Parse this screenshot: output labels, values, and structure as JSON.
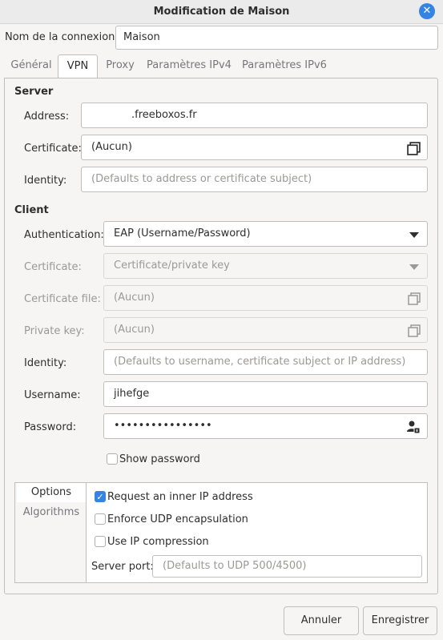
{
  "window": {
    "title": "Modification de Maison"
  },
  "connection": {
    "name_label": "Nom de la connexion",
    "name_value": "Maison"
  },
  "tabs": [
    "Général",
    "VPN",
    "Proxy",
    "Paramètres IPv4",
    "Paramètres IPv6"
  ],
  "server": {
    "heading": "Server",
    "address_label": "Address:",
    "address_value": ".freeboxos.fr",
    "certificate_label": "Certificate:",
    "certificate_value": "(Aucun)",
    "identity_label": "Identity:",
    "identity_placeholder": "(Defaults to address or certificate subject)"
  },
  "client": {
    "heading": "Client",
    "auth_label": "Authentication:",
    "auth_value": "EAP (Username/Password)",
    "certificate_label": "Certificate:",
    "certificate_value": "Certificate/private key",
    "certfile_label": "Certificate file:",
    "certfile_value": "(Aucun)",
    "privkey_label": "Private key:",
    "privkey_value": "(Aucun)",
    "identity_label": "Identity:",
    "identity_placeholder": "(Defaults to username, certificate subject or IP address)",
    "username_label": "Username:",
    "username_value": "jihefge",
    "password_label": "Password:",
    "password_value": "••••••••••••••••",
    "show_password_label": "Show password"
  },
  "options": {
    "side_tabs": [
      "Options",
      "Algorithms"
    ],
    "request_ip_label": "Request an inner IP address",
    "request_ip_checked": true,
    "udp_encap_label": "Enforce UDP encapsulation",
    "udp_encap_checked": false,
    "ip_comp_label": "Use IP compression",
    "ip_comp_checked": false,
    "server_port_label": "Server port:",
    "server_port_placeholder": "(Defaults to UDP 500/4500)"
  },
  "footer": {
    "cancel_label": "Annuler",
    "save_label": "Enregistrer"
  },
  "colors": {
    "accent": "#3584e4",
    "window_bg": "#f6f5f4"
  }
}
